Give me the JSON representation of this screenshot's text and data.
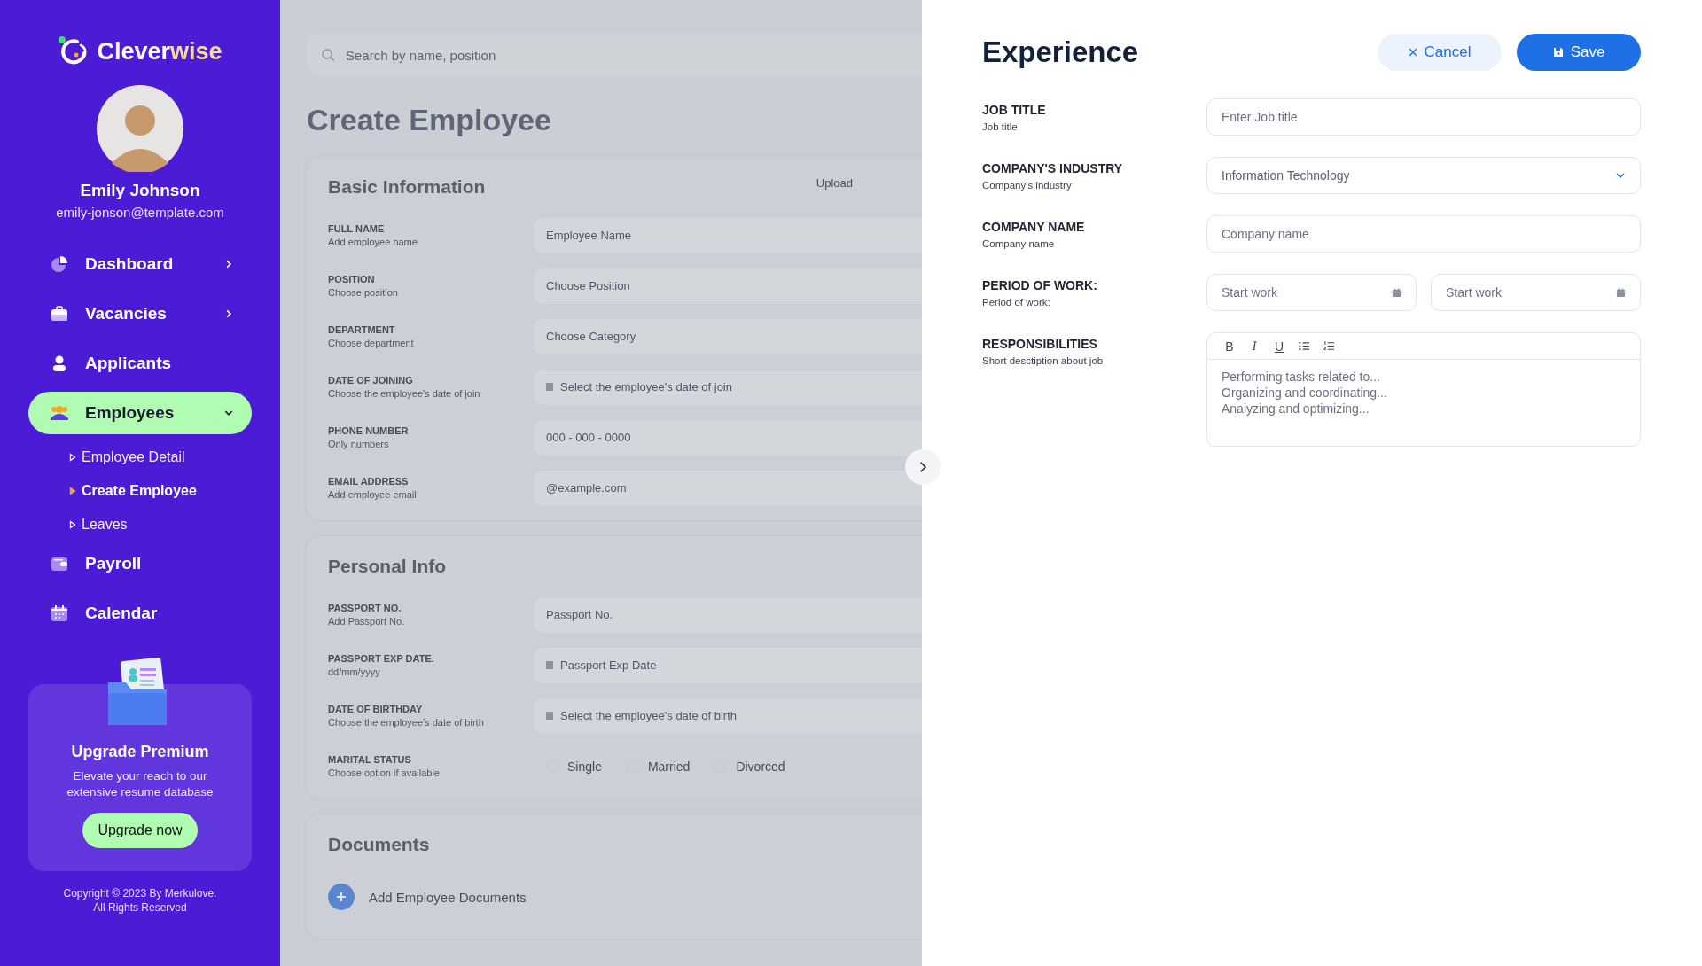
{
  "sidebar": {
    "brand": {
      "first": "Clever",
      "second": "wise"
    },
    "user": {
      "name": "Emily Johnson",
      "email": "emily-jonson@template.com"
    },
    "nav": [
      {
        "label": "Dashboard",
        "selected": false,
        "expanded": false
      },
      {
        "label": "Vacancies",
        "selected": false,
        "expanded": false
      },
      {
        "label": "Applicants",
        "selected": false
      },
      {
        "label": "Employees",
        "selected": true,
        "expanded": true,
        "children": [
          {
            "label": "Employee Detail",
            "selected": false
          },
          {
            "label": "Create Employee",
            "selected": true
          },
          {
            "label": "Leaves",
            "selected": false
          }
        ]
      },
      {
        "label": "Payroll",
        "selected": false
      },
      {
        "label": "Calendar",
        "selected": false
      }
    ],
    "promo": {
      "title": "Upgrade Premium",
      "text": "Elevate your reach to our extensive resume database",
      "button": "Upgrade now"
    },
    "copyright": [
      "Copyright © 2023 By Merkulove.",
      "All Rights Reserved"
    ]
  },
  "background_page": {
    "search_placeholder": "Search by name, position",
    "title": "Create Employee",
    "sections": [
      {
        "title": "Basic Information",
        "action": "Upload",
        "fields": [
          {
            "label": "FULL NAME",
            "hint": "Add employee name",
            "kind": "text",
            "placeholder": "Employee Name"
          },
          {
            "label": "POSITION",
            "hint": "Choose position",
            "kind": "text",
            "placeholder": "Choose Position"
          },
          {
            "label": "DEPARTMENT",
            "hint": "Choose department",
            "kind": "text",
            "placeholder": "Choose Category"
          },
          {
            "label": "DATE OF JOINING",
            "hint": "Choose the employee's date of join",
            "kind": "date",
            "placeholder": "Select the employee's date of join"
          },
          {
            "label": "PHONE NUMBER",
            "hint": "Only numbers",
            "kind": "text",
            "placeholder": "000 - 000 - 0000"
          },
          {
            "label": "EMAIL ADDRESS",
            "hint": "Add employee email",
            "kind": "text",
            "placeholder": "@example.com"
          }
        ]
      },
      {
        "title": "Personal Info",
        "fields": [
          {
            "label": "PASSPORT NO.",
            "hint": "Add Passport No.",
            "kind": "text",
            "placeholder": "Passport No."
          },
          {
            "label": "PASSPORT EXP DATE.",
            "hint": "dd/mm/yyyy",
            "kind": "date",
            "placeholder": "Passport Exp Date"
          },
          {
            "label": "DATE OF BIRTHDAY",
            "hint": "Choose the employee's date of birth",
            "kind": "date",
            "placeholder": "Select the employee's date of birth"
          },
          {
            "label": "MARITAL STATUS",
            "hint": "Choose option if available",
            "kind": "radio",
            "options": [
              {
                "label": "Single",
                "selected": false
              },
              {
                "label": "Married",
                "selected": false
              },
              {
                "label": "Divorced",
                "selected": false
              }
            ]
          }
        ]
      },
      {
        "title": "Documents",
        "add_label": "Add Employee Documents"
      }
    ]
  },
  "panel": {
    "title": "Experience",
    "cancel": "Cancel",
    "save": "Save",
    "rows": [
      {
        "label": "JOB TITLE",
        "hint": "Job title",
        "kind": "text",
        "fields": [
          {
            "placeholder": "Enter Job title"
          }
        ]
      },
      {
        "label": "COMPANY'S INDUSTRY",
        "hint": "Company's industry",
        "kind": "select",
        "fields": [
          {
            "value": "Information Technology"
          }
        ]
      },
      {
        "label": "COMPANY NAME",
        "hint": "Company name",
        "kind": "text",
        "fields": [
          {
            "placeholder": "Company name"
          }
        ]
      },
      {
        "label": "PERIOD OF WORK:",
        "hint": "Period of work:",
        "kind": "date",
        "fields": [
          {
            "placeholder": "Start work"
          },
          {
            "placeholder": "Start work"
          }
        ]
      },
      {
        "label": "RESPONSIBILITIES",
        "hint": "Short desctiption about job",
        "kind": "editor",
        "toolbar": [
          {
            "kind": "bold",
            "label": "B"
          },
          {
            "kind": "italic",
            "label": "I"
          },
          {
            "kind": "underline",
            "label": "U"
          },
          {
            "kind": "bullets"
          },
          {
            "kind": "numbers"
          }
        ],
        "placeholder": "Performing tasks related to...\nOrganizing and coordinating...\nAnalyzing and optimizing..."
      }
    ]
  }
}
